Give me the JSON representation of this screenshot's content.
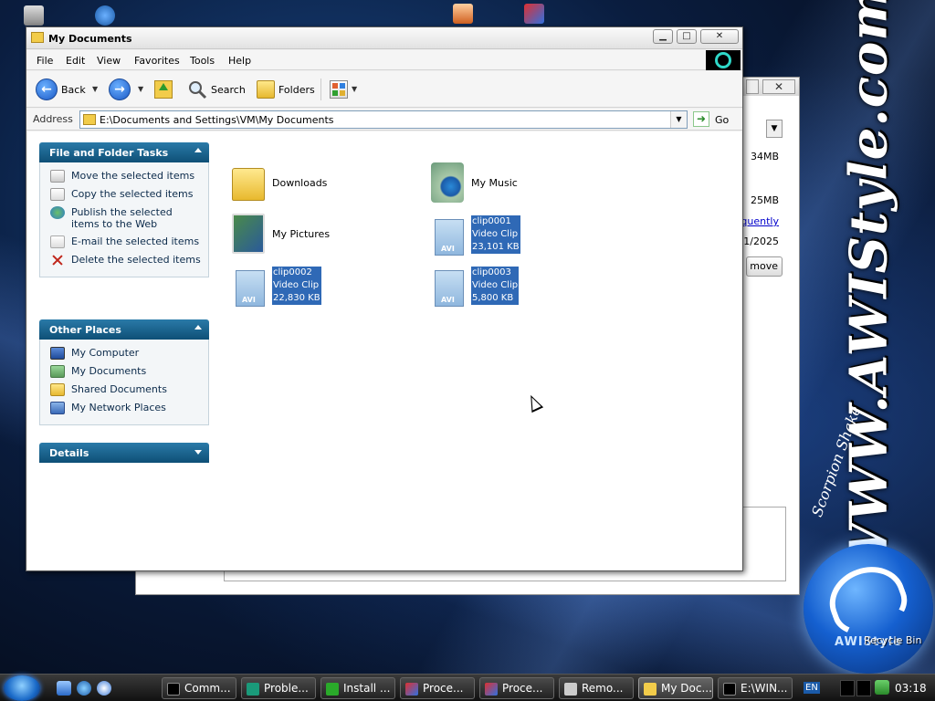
{
  "window": {
    "title": "My Documents"
  },
  "menubar": {
    "items": [
      "File",
      "Edit",
      "View",
      "Favorites",
      "Tools",
      "Help"
    ]
  },
  "toolbar": {
    "back_label": "Back",
    "search_label": "Search",
    "folders_label": "Folders"
  },
  "address": {
    "label": "Address",
    "value": "E:\\Documents and Settings\\VM\\My Documents",
    "go_label": "Go"
  },
  "tasks_panel": {
    "title": "File and Folder Tasks",
    "items": [
      {
        "label": "Move the selected items",
        "icon": "move-icon"
      },
      {
        "label": "Copy the selected items",
        "icon": "copy-icon"
      },
      {
        "label": "Publish the selected items to the Web",
        "icon": "web-publish-icon"
      },
      {
        "label": "E-mail the selected items",
        "icon": "email-icon"
      },
      {
        "label": "Delete the selected items",
        "icon": "delete-icon"
      }
    ]
  },
  "places_panel": {
    "title": "Other Places",
    "items": [
      {
        "label": "My Computer",
        "icon": "computer-icon"
      },
      {
        "label": "My Documents",
        "icon": "my-documents-icon"
      },
      {
        "label": "Shared Documents",
        "icon": "folder-icon"
      },
      {
        "label": "My Network Places",
        "icon": "network-icon"
      }
    ]
  },
  "details_panel": {
    "title": "Details"
  },
  "files": [
    {
      "name": "Downloads",
      "type": "folder",
      "selected": false
    },
    {
      "name": "My Music",
      "type": "music-folder",
      "selected": false
    },
    {
      "name": "My Pictures",
      "type": "pictures-folder",
      "selected": false
    },
    {
      "name": "clip0001",
      "kind": "Video Clip",
      "size": "23,101 KB",
      "type": "avi",
      "selected": true
    },
    {
      "name": "clip0002",
      "kind": "Video Clip",
      "size": "22,830 KB",
      "type": "avi",
      "selected": true
    },
    {
      "name": "clip0003",
      "kind": "Video Clip",
      "size": "5,800 KB",
      "type": "avi",
      "selected": true
    }
  ],
  "background_window": {
    "close_glyph": "✕",
    "size_1": "34MB",
    "size_2": "25MB",
    "link": "quently",
    "date": "1/2025",
    "button_label": "move"
  },
  "desktop": {
    "recycle_bin_label": "Recycle Bin",
    "brand_text": "WWW.AWIStyle.com",
    "brand_sign": "Scorpion Shake"
  },
  "taskbar": {
    "buttons": [
      {
        "label": "Comm...",
        "icon": "cmd-icon",
        "active": false
      },
      {
        "label": "Proble...",
        "icon": "problem-icon",
        "active": false
      },
      {
        "label": "Install ...",
        "icon": "install-icon",
        "active": false
      },
      {
        "label": "Proce...",
        "icon": "process-icon",
        "active": false
      },
      {
        "label": "Proce...",
        "icon": "process-icon",
        "active": false
      },
      {
        "label": "Remo...",
        "icon": "remove-icon",
        "active": false
      },
      {
        "label": "My Doc...",
        "icon": "folder-icon",
        "active": true
      },
      {
        "label": "E:\\WIN...",
        "icon": "cmd-icon",
        "active": false
      }
    ],
    "language": "EN",
    "clock": "03:18"
  },
  "colors": {
    "panel_header": "#0e4f76",
    "selection": "#2f69b6",
    "taskbar": "#111111"
  }
}
